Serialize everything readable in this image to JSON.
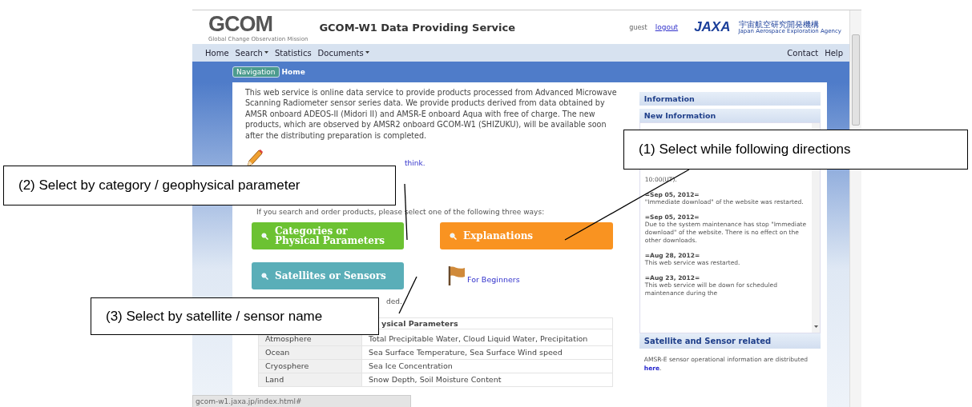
{
  "header": {
    "logo": "GCOM",
    "logo_tagline": "Global Change Observation Mission",
    "title": "GCOM-W1 Data Providing Service",
    "user": "guest",
    "logout": "logout",
    "agency_logo": "JAXA",
    "agency_name_ja": "宇宙航空研究開発機構",
    "agency_name_en": "Japan Aerospace Exploration Agency"
  },
  "nav": {
    "left": [
      {
        "label": "Home",
        "has_menu": false
      },
      {
        "label": "Search",
        "has_menu": true
      },
      {
        "label": "Statistics",
        "has_menu": false
      },
      {
        "label": "Documents",
        "has_menu": true
      }
    ],
    "right": [
      "Contact",
      "Help"
    ]
  },
  "breadcrumb": {
    "label": "Navigation",
    "current": "Home"
  },
  "intro": "This web service is online data service to provide products processed from Advanced Microwave Scanning Radiometer sensor series data. We provide products derived from data obtained by AMSR onboard ADEOS-II (Midori II) and AMSR-E onboard Aqua with free of charge. The new products, which are observed by AMSR2 onboard GCOM-W1 (SHIZUKU), will be available soon after the distributing preparation is completed.",
  "pencil_link": "think.",
  "instruction": "If you search and order products, please select one of the following three ways:",
  "search_buttons": [
    {
      "lines": [
        "Categories or",
        "Physical Parameters"
      ],
      "color": "#6cc232"
    },
    {
      "lines": [
        "Explanations"
      ],
      "color": "#f99321"
    },
    {
      "lines": [
        "Satellites or Sensors"
      ],
      "color": "#5aaeb8"
    }
  ],
  "beginners_link": "For Beginners",
  "note_fragment": "ded.",
  "table": {
    "heading_2": "ysical Parameters",
    "rows": [
      {
        "category": "Atmosphere",
        "parameters": "Total Precipitable Water, Cloud Liquid Water, Precipitation"
      },
      {
        "category": "Ocean",
        "parameters": "Sea Surface Temperature, Sea Surface Wind speed"
      },
      {
        "category": "Cryosphere",
        "parameters": "Sea Ice Concentration"
      },
      {
        "category": "Land",
        "parameters": "Snow Depth, Soil Moisture Content"
      }
    ]
  },
  "sidebar": {
    "title": "Information",
    "new_info_title": "New Information",
    "fragment": "10:00(UT).",
    "news": [
      {
        "date": "=Sep 05, 2012=",
        "text": "\"Immediate download\" of the website was restarted."
      },
      {
        "date": "=Sep 05, 2012=",
        "text": "Due to the system maintenance has stop \"Immediate download\" of the website. There is no effect on the other downloads."
      },
      {
        "date": "=Aug 28, 2012=",
        "text": "This web service was restarted."
      },
      {
        "date": "=Aug 23, 2012=",
        "text": "This web service will be down for scheduled maintenance during the"
      }
    ],
    "section_2_title": "Satellite and Sensor related",
    "section_2_text": "AMSR-E sensor operational information are distributed",
    "section_2_link": "here",
    "section_2_tail": "."
  },
  "status_bar": "gcom-w1.jaxa.jp/index.html#",
  "callouts": [
    {
      "text": "(1) Select while following directions"
    },
    {
      "text": "(2) Select by category / geophysical parameter"
    },
    {
      "text": "(3) Select by satellite / sensor name"
    }
  ]
}
